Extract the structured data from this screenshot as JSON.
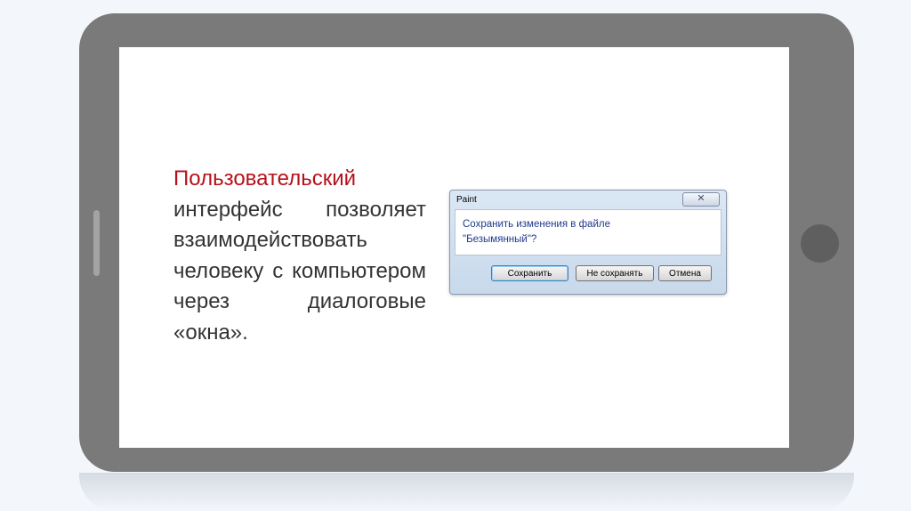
{
  "slide": {
    "text_highlight": "Пользовательский",
    "text_rest": "интерфейс позволяет взаимодействовать человеку с компьютером через диалоговые «окна»."
  },
  "dialog": {
    "title": "Paint",
    "close_label": "✕",
    "message_line1": "Сохранить изменения в файле",
    "message_line2": "\"Безымянный\"?",
    "buttons": {
      "save": "Сохранить",
      "dont_save": "Не сохранять",
      "cancel": "Отмена"
    }
  },
  "colors": {
    "accent_text": "#b5121b",
    "tablet_frame": "#7a7a7a",
    "dialog_message": "#1e3a8c"
  },
  "icons": {
    "home_button": "circle-icon",
    "side_slot": "slot-icon"
  }
}
